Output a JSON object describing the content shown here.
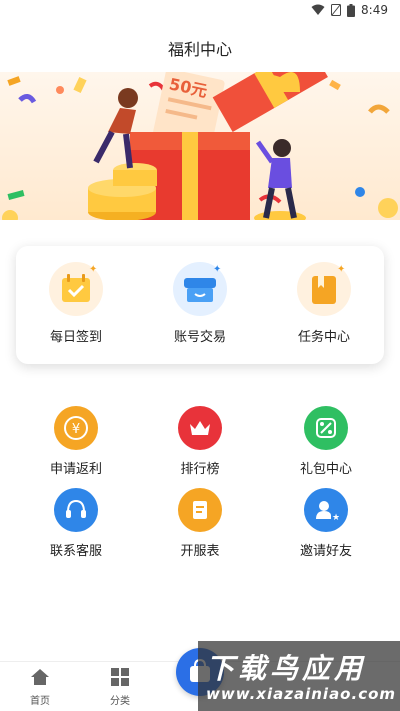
{
  "status_bar": {
    "time": "8:49",
    "icons": [
      "wifi-icon",
      "sim-icon",
      "battery-icon"
    ]
  },
  "page": {
    "title": "福利中心"
  },
  "banner": {
    "price_text": "50元"
  },
  "quick_card": {
    "items": [
      {
        "label": "每日签到",
        "icon": "calendar-check-icon"
      },
      {
        "label": "账号交易",
        "icon": "shop-icon"
      },
      {
        "label": "任务中心",
        "icon": "book-icon"
      }
    ]
  },
  "services": {
    "items": [
      {
        "label": "申请返利",
        "icon": "yen-icon",
        "color": "#f5a524"
      },
      {
        "label": "排行榜",
        "icon": "crown-icon",
        "color": "#e8333a"
      },
      {
        "label": "礼包中心",
        "icon": "coupon-icon",
        "color": "#2fbf62"
      },
      {
        "label": "联系客服",
        "icon": "headset-icon",
        "color": "#2f86e8"
      },
      {
        "label": "开服表",
        "icon": "document-icon",
        "color": "#f5a524"
      },
      {
        "label": "邀请好友",
        "icon": "user-star-icon",
        "color": "#2f86e8"
      }
    ]
  },
  "bottom_nav": {
    "items": [
      {
        "label": "首页",
        "icon": "home-icon"
      },
      {
        "label": "分类",
        "icon": "grid-icon"
      }
    ],
    "center_icon": "shop-bag-icon"
  },
  "watermark": {
    "title": "下载鸟应用",
    "url": "www.xiazainiao.com"
  }
}
